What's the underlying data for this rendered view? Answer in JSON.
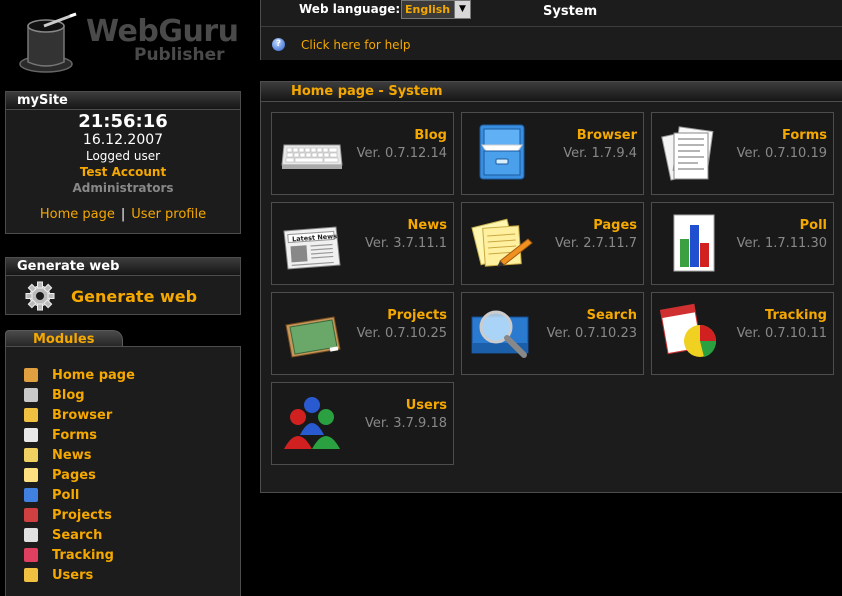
{
  "logo": {
    "brand_line1": "WebGuru",
    "brand_line2": "Publisher"
  },
  "topbar": {
    "web_language_label": "Web language:",
    "language_value": "English",
    "section": "System",
    "help_link": "Click here for help"
  },
  "mysite": {
    "title": "mySite",
    "time": "21:56:16",
    "date": "16.12.2007",
    "logged_label": "Logged user",
    "account": "Test Account",
    "role": "Administrators",
    "home_link": "Home page",
    "separator": "|",
    "profile_link": "User profile"
  },
  "generate": {
    "title": "Generate web",
    "button_label": "Generate web"
  },
  "modules": {
    "title": "Modules",
    "items": [
      {
        "label": "Home page",
        "icon": "house-icon",
        "color": "#e0a040"
      },
      {
        "label": "Blog",
        "icon": "blog-icon",
        "color": "#c8c8c8"
      },
      {
        "label": "Browser",
        "icon": "folder-icon",
        "color": "#f0c040"
      },
      {
        "label": "Forms",
        "icon": "forms-icon",
        "color": "#e8e8e8"
      },
      {
        "label": "News",
        "icon": "news-icon",
        "color": "#f0d060"
      },
      {
        "label": "Pages",
        "icon": "pages-icon",
        "color": "#ffe080"
      },
      {
        "label": "Poll",
        "icon": "poll-icon",
        "color": "#4080e0"
      },
      {
        "label": "Projects",
        "icon": "projects-icon",
        "color": "#d04040"
      },
      {
        "label": "Search",
        "icon": "search-icon",
        "color": "#e0e0e0"
      },
      {
        "label": "Tracking",
        "icon": "tracking-icon",
        "color": "#e04060"
      },
      {
        "label": "Users",
        "icon": "users-icon",
        "color": "#f0c040"
      }
    ]
  },
  "main": {
    "title": "Home page  - System",
    "tiles": [
      {
        "name": "Blog",
        "version": "Ver. 0.7.12.14",
        "icon": "keyboard-icon"
      },
      {
        "name": "Browser",
        "version": "Ver. 1.7.9.4",
        "icon": "filing-cabinet-icon"
      },
      {
        "name": "Forms",
        "version": "Ver. 0.7.10.19",
        "icon": "documents-icon"
      },
      {
        "name": "News",
        "version": "Ver. 3.7.11.1",
        "icon": "newspaper-icon",
        "icon_text": "Latest News"
      },
      {
        "name": "Pages",
        "version": "Ver. 2.7.11.7",
        "icon": "notes-pencil-icon"
      },
      {
        "name": "Poll",
        "version": "Ver. 1.7.11.30",
        "icon": "bar-chart-icon"
      },
      {
        "name": "Projects",
        "version": "Ver. 0.7.10.25",
        "icon": "chalkboard-icon"
      },
      {
        "name": "Search",
        "version": "Ver. 0.7.10.23",
        "icon": "magnifier-icon"
      },
      {
        "name": "Tracking",
        "version": "Ver. 0.7.10.11",
        "icon": "pie-chart-icon"
      },
      {
        "name": "Users",
        "version": "Ver. 3.7.9.18",
        "icon": "users-group-icon"
      }
    ]
  },
  "colors": {
    "accent": "#f5a800",
    "panel": "#1c1c1c",
    "border": "#4d4d4d",
    "muted": "#888888"
  }
}
